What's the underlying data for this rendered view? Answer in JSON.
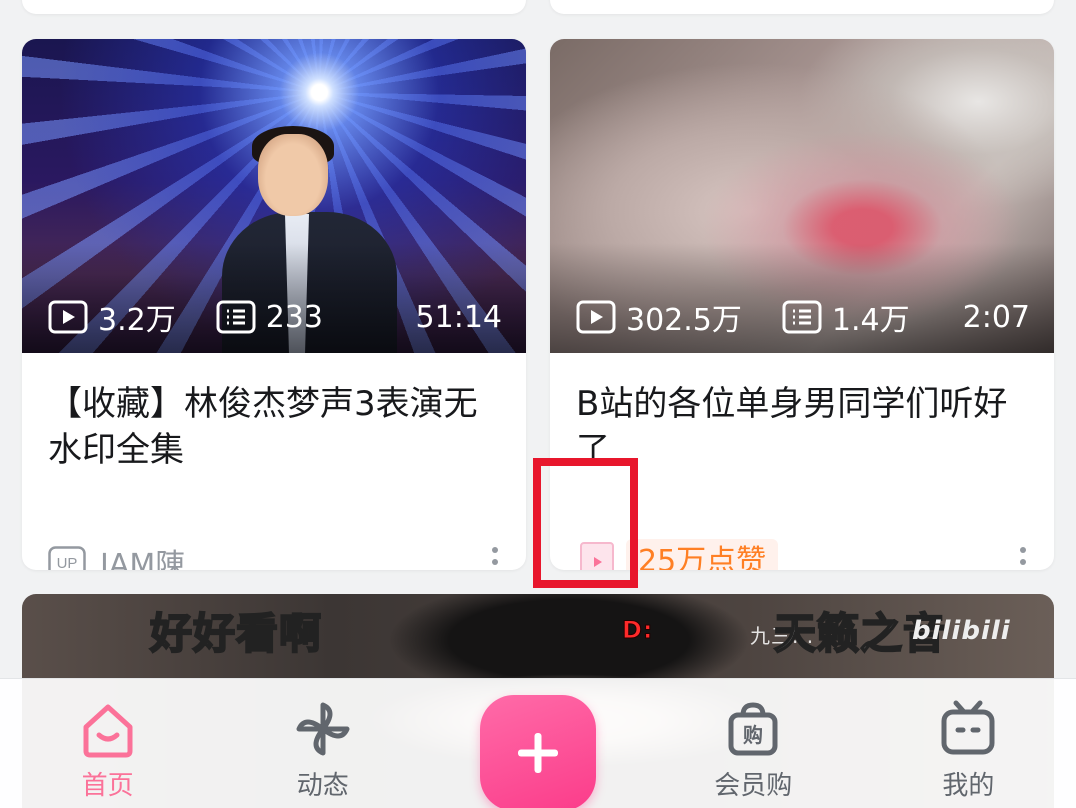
{
  "feed": {
    "cards": [
      {
        "views": "3.2万",
        "danmaku_count": "233",
        "duration": "51:14",
        "title": "【收藏】林俊杰梦声3表演无水印全集",
        "up_badge": "UP",
        "uploader": "IAM陳"
      },
      {
        "views": "302.5万",
        "danmaku_count": "1.4万",
        "duration": "2:07",
        "title": "B站的各位单身男同学们听好了",
        "reason_icon": "play-tag-icon",
        "reason_label": "25万点赞"
      }
    ],
    "partial_card": {
      "danmaku": [
        "好好看啊",
        "天籁之音",
        "D:",
        "九三...",
        "bilibili"
      ]
    }
  },
  "tabbar": {
    "items": [
      {
        "label": "首页",
        "icon": "home-icon",
        "active": true
      },
      {
        "label": "动态",
        "icon": "pinwheel-icon",
        "active": false
      },
      {
        "label": "",
        "icon": "plus-icon",
        "active": false
      },
      {
        "label": "会员购",
        "icon": "shopping-bag-icon",
        "active": false
      },
      {
        "label": "我的",
        "icon": "tv-icon",
        "active": false
      }
    ]
  },
  "colors": {
    "brand_pink": "#fb7299",
    "highlight_red": "#e8162c",
    "like_orange": "#ff7f24"
  }
}
